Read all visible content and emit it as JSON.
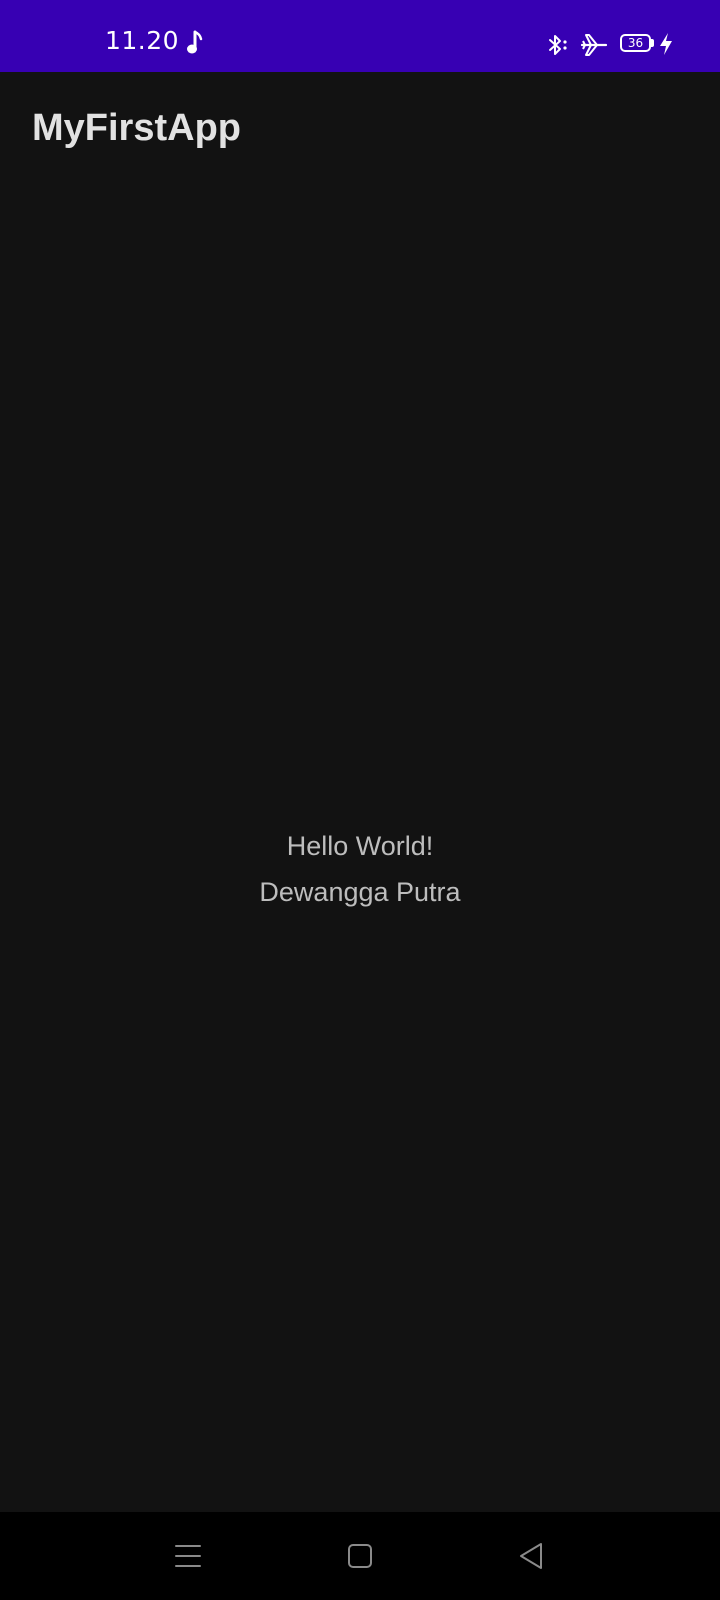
{
  "status_bar": {
    "time": "11.20",
    "battery_level": "36",
    "icons": [
      "music-note-icon",
      "bluetooth-icon",
      "airplane-mode-icon",
      "battery-icon",
      "charging-bolt-icon"
    ],
    "background_color": "#3700B3"
  },
  "app_bar": {
    "title": "MyFirstApp"
  },
  "main": {
    "greeting": "Hello World!",
    "name": "Dewangga Putra"
  },
  "nav_bar": {
    "buttons": [
      "menu-icon",
      "home-icon",
      "back-icon"
    ]
  },
  "colors": {
    "background": "#121212",
    "status_bar": "#3700B3",
    "title_text": "#e2e2e2",
    "body_text": "#bdbdbd"
  }
}
